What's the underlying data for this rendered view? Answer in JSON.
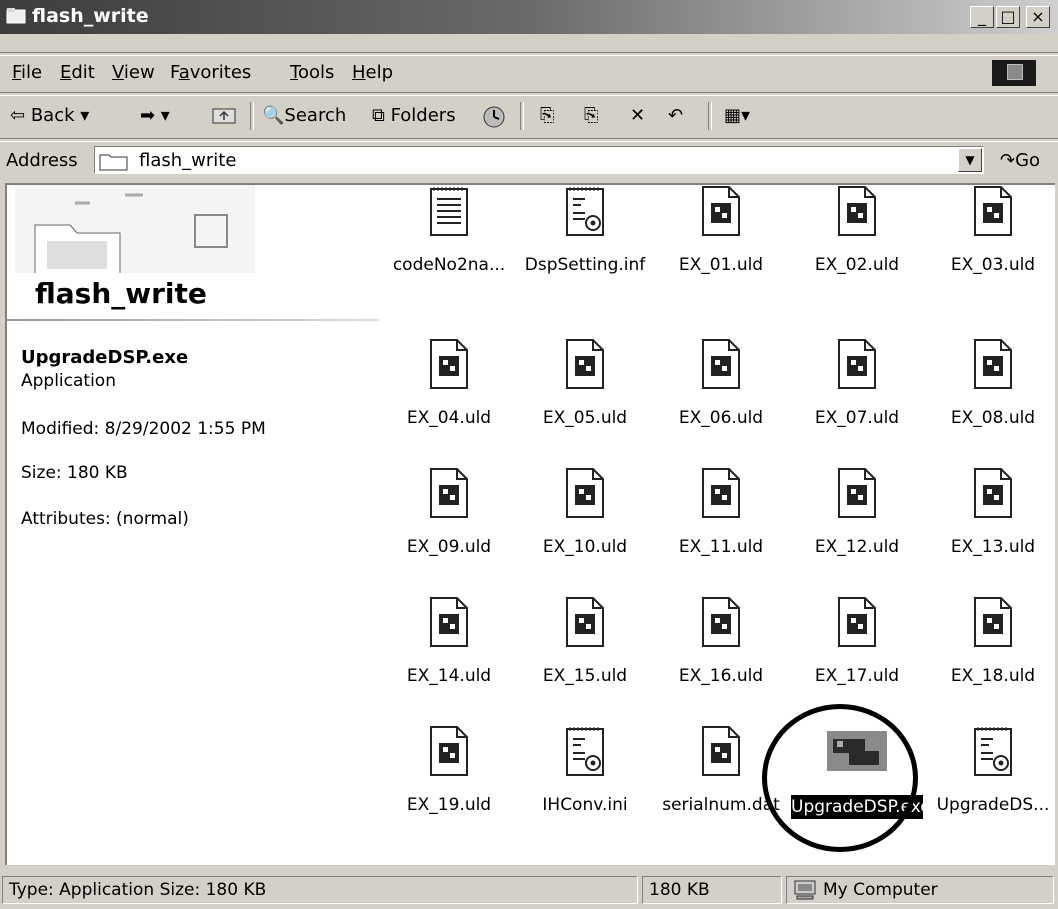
{
  "window": {
    "title": "flash_write",
    "buttons": [
      "_",
      "□",
      "×"
    ]
  },
  "menu": [
    "File",
    "Edit",
    "View",
    "Favorites",
    "Tools",
    "Help"
  ],
  "menu_accel": [
    "F",
    "E",
    "V",
    "a",
    "T",
    "H"
  ],
  "toolbar": {
    "back": "Back",
    "search": "Search",
    "folders": "Folders"
  },
  "address": {
    "label": "Address",
    "value": "flash_write",
    "go": "Go"
  },
  "sidebar": {
    "title": "flash_write",
    "selected_name": "UpgradeDSP.exe",
    "selected_type": "Application",
    "modified": "Modified: 8/29/2002 1:55 PM",
    "size": "Size: 180 KB",
    "attributes": "Attributes: (normal)"
  },
  "files": [
    {
      "name": "codeNo2na...",
      "icon": "text-file-icon"
    },
    {
      "name": "DspSetting.inf",
      "icon": "settings-file-icon"
    },
    {
      "name": "EX_01.uld",
      "icon": "uld-file-icon"
    },
    {
      "name": "EX_02.uld",
      "icon": "uld-file-icon"
    },
    {
      "name": "EX_03.uld",
      "icon": "uld-file-icon"
    },
    {
      "name": "EX_04.uld",
      "icon": "uld-file-icon"
    },
    {
      "name": "EX_05.uld",
      "icon": "uld-file-icon"
    },
    {
      "name": "EX_06.uld",
      "icon": "uld-file-icon"
    },
    {
      "name": "EX_07.uld",
      "icon": "uld-file-icon"
    },
    {
      "name": "EX_08.uld",
      "icon": "uld-file-icon"
    },
    {
      "name": "EX_09.uld",
      "icon": "uld-file-icon"
    },
    {
      "name": "EX_10.uld",
      "icon": "uld-file-icon"
    },
    {
      "name": "EX_11.uld",
      "icon": "uld-file-icon"
    },
    {
      "name": "EX_12.uld",
      "icon": "uld-file-icon"
    },
    {
      "name": "EX_13.uld",
      "icon": "uld-file-icon"
    },
    {
      "name": "EX_14.uld",
      "icon": "uld-file-icon"
    },
    {
      "name": "EX_15.uld",
      "icon": "uld-file-icon"
    },
    {
      "name": "EX_16.uld",
      "icon": "uld-file-icon"
    },
    {
      "name": "EX_17.uld",
      "icon": "uld-file-icon"
    },
    {
      "name": "EX_18.uld",
      "icon": "uld-file-icon"
    },
    {
      "name": "EX_19.uld",
      "icon": "uld-file-icon"
    },
    {
      "name": "IHConv.ini",
      "icon": "settings-file-icon"
    },
    {
      "name": "serialnum.dat",
      "icon": "uld-file-icon"
    },
    {
      "name": "UpgradeDSP.exe",
      "icon": "application-icon",
      "selected": true
    },
    {
      "name": "UpgradeDS...",
      "icon": "settings-file-icon"
    }
  ],
  "status": {
    "main": "Type: Application Size: 180 KB",
    "size": "180 KB",
    "zone": "My Computer"
  }
}
